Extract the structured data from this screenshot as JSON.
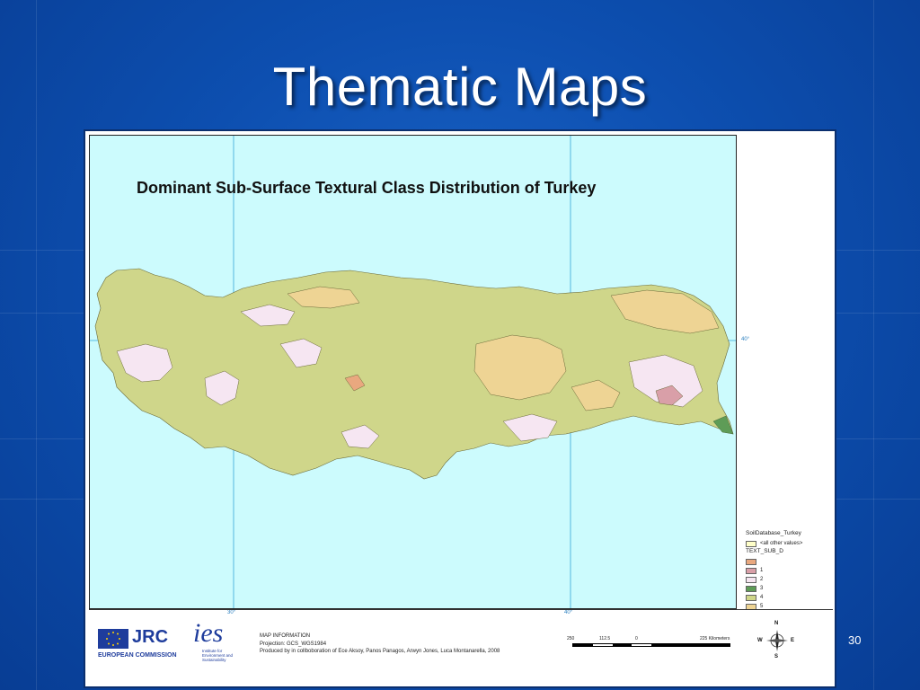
{
  "slide": {
    "title": "Thematic Maps",
    "page_number": "30",
    "background_color": "#0d4fb0"
  },
  "map": {
    "title": "Dominant Sub-Surface Textural Class Distribution of Turkey",
    "graticule_labels": {
      "bottom": [
        "30°",
        "40°"
      ],
      "right": [
        "40°"
      ]
    },
    "sea_color": "#ccfbfd",
    "legend": {
      "layer": "SoilDatabase_Turkey",
      "all_other_values": "<all other values>",
      "field": "TEXT_SUB_D",
      "classes": [
        {
          "label": "",
          "color": "#e9a87f"
        },
        {
          "label": "1",
          "color": "#d99fa8"
        },
        {
          "label": "2",
          "color": "#f6e6f2"
        },
        {
          "label": "3",
          "color": "#5e9c57"
        },
        {
          "label": "4",
          "color": "#cfd68a"
        },
        {
          "label": "5",
          "color": "#eed494"
        }
      ]
    },
    "info": {
      "heading": "MAP INFORMATION",
      "projection": "Projection: GCS_WGS1984",
      "credits": "Produced by in collboboration of Ece Aksoy, Panos Panagos, Arwyn Jones, Luca Montanarella, 2008"
    },
    "scale": {
      "labels": [
        "250",
        "112.5",
        "0",
        "225 Kilometers"
      ]
    },
    "compass": {
      "n": "N",
      "s": "S",
      "e": "E",
      "w": "W"
    },
    "logos": {
      "jrc": "JRC",
      "ec": "EUROPEAN COMMISSION",
      "ies": "ies",
      "ies_sub": "Institute for Environment and Sustainability"
    }
  }
}
